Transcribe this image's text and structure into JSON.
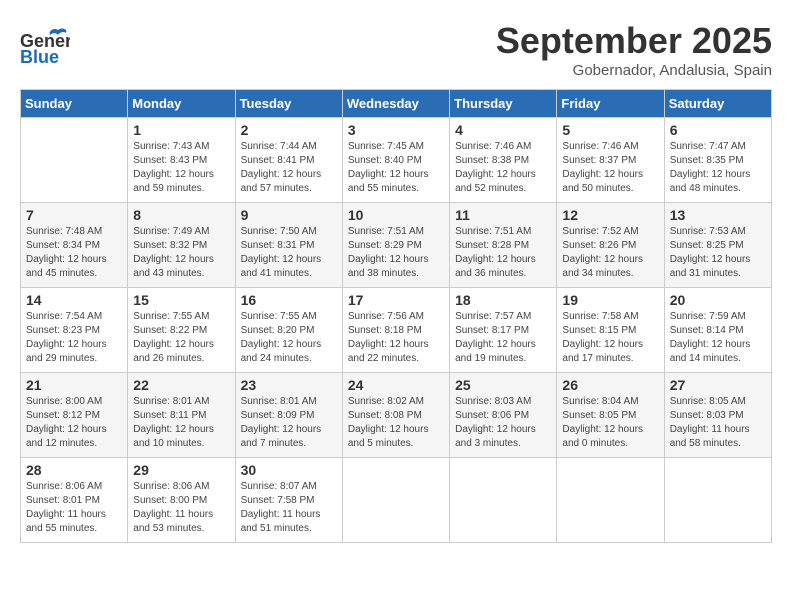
{
  "header": {
    "logo_general": "General",
    "logo_blue": "Blue",
    "month_title": "September 2025",
    "location": "Gobernador, Andalusia, Spain"
  },
  "weekdays": [
    "Sunday",
    "Monday",
    "Tuesday",
    "Wednesday",
    "Thursday",
    "Friday",
    "Saturday"
  ],
  "weeks": [
    [
      {
        "day": "",
        "sunrise": "",
        "sunset": "",
        "daylight": ""
      },
      {
        "day": "1",
        "sunrise": "Sunrise: 7:43 AM",
        "sunset": "Sunset: 8:43 PM",
        "daylight": "Daylight: 12 hours and 59 minutes."
      },
      {
        "day": "2",
        "sunrise": "Sunrise: 7:44 AM",
        "sunset": "Sunset: 8:41 PM",
        "daylight": "Daylight: 12 hours and 57 minutes."
      },
      {
        "day": "3",
        "sunrise": "Sunrise: 7:45 AM",
        "sunset": "Sunset: 8:40 PM",
        "daylight": "Daylight: 12 hours and 55 minutes."
      },
      {
        "day": "4",
        "sunrise": "Sunrise: 7:46 AM",
        "sunset": "Sunset: 8:38 PM",
        "daylight": "Daylight: 12 hours and 52 minutes."
      },
      {
        "day": "5",
        "sunrise": "Sunrise: 7:46 AM",
        "sunset": "Sunset: 8:37 PM",
        "daylight": "Daylight: 12 hours and 50 minutes."
      },
      {
        "day": "6",
        "sunrise": "Sunrise: 7:47 AM",
        "sunset": "Sunset: 8:35 PM",
        "daylight": "Daylight: 12 hours and 48 minutes."
      }
    ],
    [
      {
        "day": "7",
        "sunrise": "Sunrise: 7:48 AM",
        "sunset": "Sunset: 8:34 PM",
        "daylight": "Daylight: 12 hours and 45 minutes."
      },
      {
        "day": "8",
        "sunrise": "Sunrise: 7:49 AM",
        "sunset": "Sunset: 8:32 PM",
        "daylight": "Daylight: 12 hours and 43 minutes."
      },
      {
        "day": "9",
        "sunrise": "Sunrise: 7:50 AM",
        "sunset": "Sunset: 8:31 PM",
        "daylight": "Daylight: 12 hours and 41 minutes."
      },
      {
        "day": "10",
        "sunrise": "Sunrise: 7:51 AM",
        "sunset": "Sunset: 8:29 PM",
        "daylight": "Daylight: 12 hours and 38 minutes."
      },
      {
        "day": "11",
        "sunrise": "Sunrise: 7:51 AM",
        "sunset": "Sunset: 8:28 PM",
        "daylight": "Daylight: 12 hours and 36 minutes."
      },
      {
        "day": "12",
        "sunrise": "Sunrise: 7:52 AM",
        "sunset": "Sunset: 8:26 PM",
        "daylight": "Daylight: 12 hours and 34 minutes."
      },
      {
        "day": "13",
        "sunrise": "Sunrise: 7:53 AM",
        "sunset": "Sunset: 8:25 PM",
        "daylight": "Daylight: 12 hours and 31 minutes."
      }
    ],
    [
      {
        "day": "14",
        "sunrise": "Sunrise: 7:54 AM",
        "sunset": "Sunset: 8:23 PM",
        "daylight": "Daylight: 12 hours and 29 minutes."
      },
      {
        "day": "15",
        "sunrise": "Sunrise: 7:55 AM",
        "sunset": "Sunset: 8:22 PM",
        "daylight": "Daylight: 12 hours and 26 minutes."
      },
      {
        "day": "16",
        "sunrise": "Sunrise: 7:55 AM",
        "sunset": "Sunset: 8:20 PM",
        "daylight": "Daylight: 12 hours and 24 minutes."
      },
      {
        "day": "17",
        "sunrise": "Sunrise: 7:56 AM",
        "sunset": "Sunset: 8:18 PM",
        "daylight": "Daylight: 12 hours and 22 minutes."
      },
      {
        "day": "18",
        "sunrise": "Sunrise: 7:57 AM",
        "sunset": "Sunset: 8:17 PM",
        "daylight": "Daylight: 12 hours and 19 minutes."
      },
      {
        "day": "19",
        "sunrise": "Sunrise: 7:58 AM",
        "sunset": "Sunset: 8:15 PM",
        "daylight": "Daylight: 12 hours and 17 minutes."
      },
      {
        "day": "20",
        "sunrise": "Sunrise: 7:59 AM",
        "sunset": "Sunset: 8:14 PM",
        "daylight": "Daylight: 12 hours and 14 minutes."
      }
    ],
    [
      {
        "day": "21",
        "sunrise": "Sunrise: 8:00 AM",
        "sunset": "Sunset: 8:12 PM",
        "daylight": "Daylight: 12 hours and 12 minutes."
      },
      {
        "day": "22",
        "sunrise": "Sunrise: 8:01 AM",
        "sunset": "Sunset: 8:11 PM",
        "daylight": "Daylight: 12 hours and 10 minutes."
      },
      {
        "day": "23",
        "sunrise": "Sunrise: 8:01 AM",
        "sunset": "Sunset: 8:09 PM",
        "daylight": "Daylight: 12 hours and 7 minutes."
      },
      {
        "day": "24",
        "sunrise": "Sunrise: 8:02 AM",
        "sunset": "Sunset: 8:08 PM",
        "daylight": "Daylight: 12 hours and 5 minutes."
      },
      {
        "day": "25",
        "sunrise": "Sunrise: 8:03 AM",
        "sunset": "Sunset: 8:06 PM",
        "daylight": "Daylight: 12 hours and 3 minutes."
      },
      {
        "day": "26",
        "sunrise": "Sunrise: 8:04 AM",
        "sunset": "Sunset: 8:05 PM",
        "daylight": "Daylight: 12 hours and 0 minutes."
      },
      {
        "day": "27",
        "sunrise": "Sunrise: 8:05 AM",
        "sunset": "Sunset: 8:03 PM",
        "daylight": "Daylight: 11 hours and 58 minutes."
      }
    ],
    [
      {
        "day": "28",
        "sunrise": "Sunrise: 8:06 AM",
        "sunset": "Sunset: 8:01 PM",
        "daylight": "Daylight: 11 hours and 55 minutes."
      },
      {
        "day": "29",
        "sunrise": "Sunrise: 8:06 AM",
        "sunset": "Sunset: 8:00 PM",
        "daylight": "Daylight: 11 hours and 53 minutes."
      },
      {
        "day": "30",
        "sunrise": "Sunrise: 8:07 AM",
        "sunset": "Sunset: 7:58 PM",
        "daylight": "Daylight: 11 hours and 51 minutes."
      },
      {
        "day": "",
        "sunrise": "",
        "sunset": "",
        "daylight": ""
      },
      {
        "day": "",
        "sunrise": "",
        "sunset": "",
        "daylight": ""
      },
      {
        "day": "",
        "sunrise": "",
        "sunset": "",
        "daylight": ""
      },
      {
        "day": "",
        "sunrise": "",
        "sunset": "",
        "daylight": ""
      }
    ]
  ]
}
